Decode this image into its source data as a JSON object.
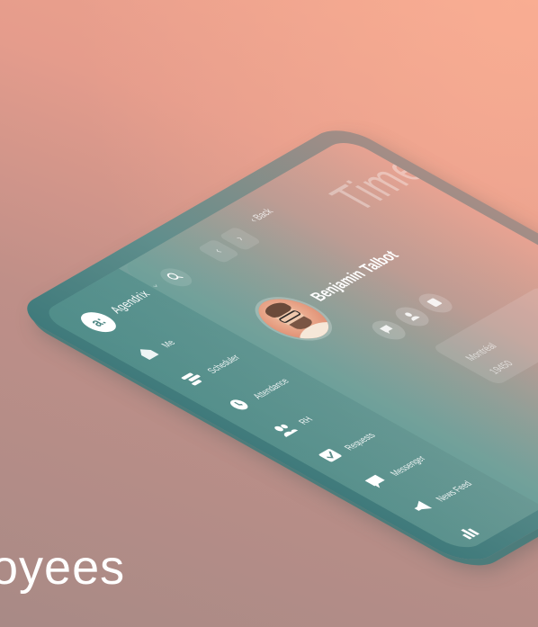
{
  "brand": {
    "name": "Agendrix",
    "logo_mark": "a:"
  },
  "sidebar": {
    "items": [
      {
        "label": "Me",
        "icon": "home-icon"
      },
      {
        "label": "Scheduler",
        "icon": "scheduler-icon"
      },
      {
        "label": "Attendance",
        "icon": "clock-icon"
      },
      {
        "label": "RH",
        "icon": "people-icon"
      },
      {
        "label": "Requests",
        "icon": "inbox-icon"
      },
      {
        "label": "Messenger",
        "icon": "chat-icon"
      },
      {
        "label": "News Feed",
        "icon": "megaphone-icon"
      },
      {
        "label": "",
        "icon": "chart-icon"
      }
    ]
  },
  "header": {
    "back_label": "‹ Back",
    "title": "Time b"
  },
  "profile": {
    "name": "Benjamin Talbot"
  },
  "details": {
    "location": "Montréal",
    "number": "19450"
  },
  "caption": "oyees",
  "colors": {
    "accent_teal": "#4f8784",
    "accent_coral": "#f2a58e"
  }
}
